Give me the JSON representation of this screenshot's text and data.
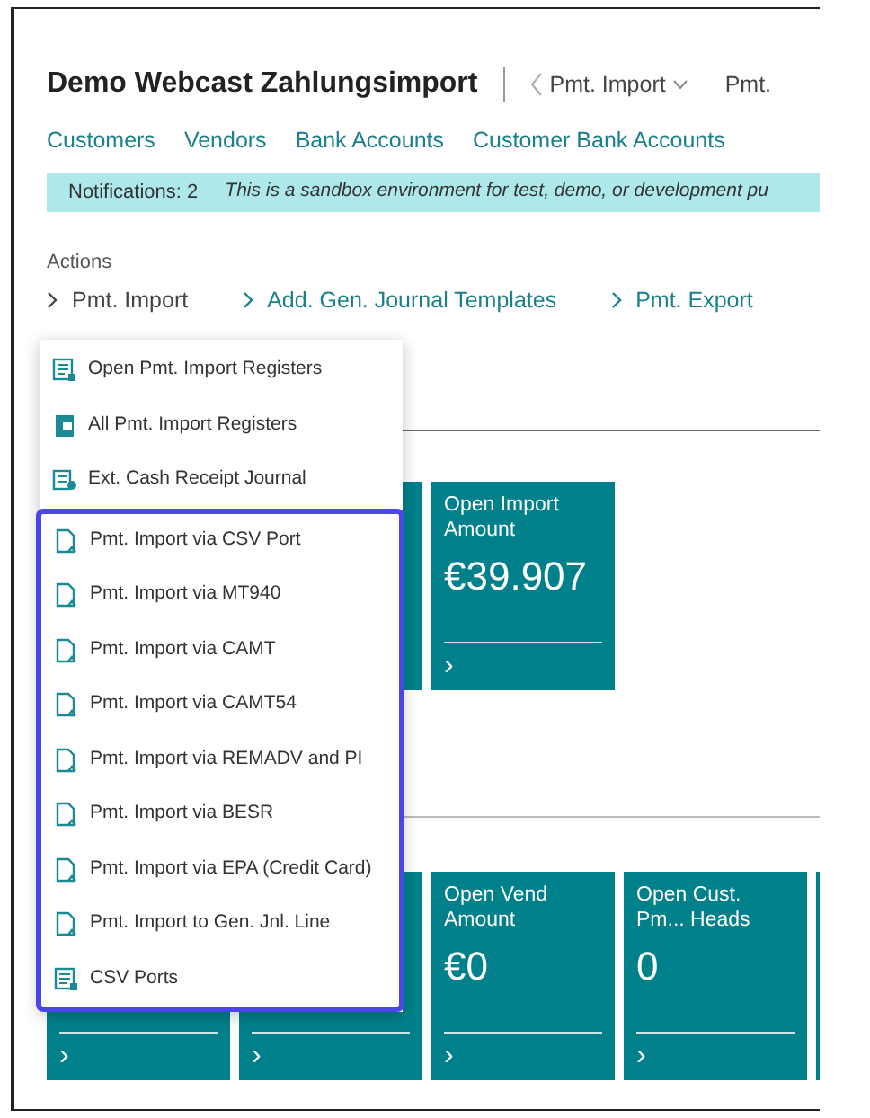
{
  "header": {
    "title": "Demo Webcast Zahlungsimport",
    "breadcrumb": "Pmt. Import",
    "next_page": "Pmt."
  },
  "nav_links": [
    "Customers",
    "Vendors",
    "Bank Accounts",
    "Customer Bank Accounts"
  ],
  "notification": {
    "count_label": "Notifications: 2",
    "message": "This is a sandbox environment for test, demo, or development pu"
  },
  "actions": {
    "label": "Actions",
    "items": [
      {
        "label": "Pmt. Import",
        "expanded": true
      },
      {
        "label": "Add. Gen. Journal Templates",
        "expanded": false
      },
      {
        "label": "Pmt. Export",
        "expanded": false
      }
    ]
  },
  "menu": {
    "items": [
      {
        "label": "Open Pmt. Import Registers",
        "kind": "register"
      },
      {
        "label": "All Pmt. Import Registers",
        "kind": "book"
      },
      {
        "label": "Ext. Cash Receipt Journal",
        "kind": "journal"
      }
    ],
    "highlighted_items": [
      {
        "label": "Pmt. Import via CSV Port",
        "kind": "import"
      },
      {
        "label": "Pmt. Import via MT940",
        "kind": "import"
      },
      {
        "label": "Pmt. Import via CAMT",
        "kind": "import"
      },
      {
        "label": "Pmt. Import via CAMT54",
        "kind": "import"
      },
      {
        "label": "Pmt. Import via REMADV and PI",
        "kind": "import"
      },
      {
        "label": "Pmt. Import via BESR",
        "kind": "import"
      },
      {
        "label": "Pmt. Import via EPA (Credit Card)",
        "kind": "import"
      },
      {
        "label": "Pmt. Import to Gen. Jnl. Line",
        "kind": "import"
      },
      {
        "label": "CSV Ports",
        "kind": "register"
      }
    ]
  },
  "tile_rows": [
    {
      "tiles": [
        {
          "kind": "covered"
        },
        {
          "kind": "metric",
          "title": "Open Import Amount",
          "value": "€39.907",
          "arrow": "›"
        }
      ]
    },
    {
      "tiles": [
        {
          "kind": "metric",
          "arrow": "›"
        },
        {
          "kind": "metric",
          "arrow": "›"
        },
        {
          "kind": "metric",
          "title": "Open Vend Amount",
          "value": "€0",
          "arrow": "›"
        },
        {
          "kind": "metric",
          "title": "Open Cust. Pm... Heads",
          "value": "0",
          "arrow": "›"
        },
        {
          "kind": "covered"
        }
      ]
    }
  ]
}
